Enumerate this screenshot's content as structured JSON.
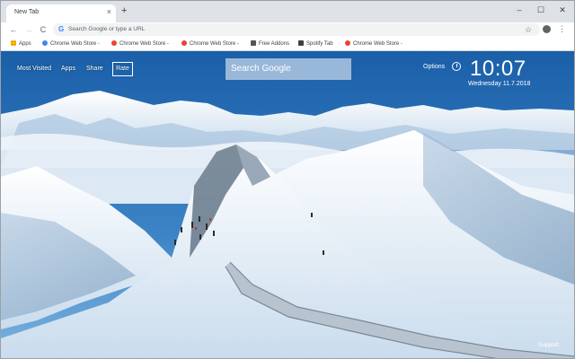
{
  "browser": {
    "tab_title": "New Tab",
    "tab_close": "×",
    "new_tab": "+",
    "window_minimize": "–",
    "window_maximize": "☐",
    "window_close": "✕",
    "back": "←",
    "forward": "→",
    "reload": "C",
    "omnibox_logo": "G",
    "omnibox_placeholder": "Search Google or type a URL",
    "star": "☆",
    "menu": "⋮"
  },
  "bookmarks": [
    {
      "label": "Apps",
      "icon": "apps-icon"
    },
    {
      "label": "Chrome Web Store -",
      "icon": "chrome-web-store-icon"
    },
    {
      "label": "Chrome Web Store -",
      "icon": "chrome-web-store-icon"
    },
    {
      "label": "Chrome Web Store -",
      "icon": "chrome-web-store-icon"
    },
    {
      "label": "Free Addons",
      "icon": "free-addons-icon"
    },
    {
      "label": "Spotify Tab",
      "icon": "spotify-tab-icon"
    },
    {
      "label": "Chrome Web Store -",
      "icon": "chrome-web-store-icon"
    }
  ],
  "page": {
    "links": {
      "most_visited": "Most Visited",
      "apps": "Apps",
      "share": "Share",
      "rate": "Rate"
    },
    "search_placeholder": "Search Google",
    "options": "Options",
    "time": "10:07",
    "date": "Wednesday  11.7.2018",
    "support": "Support"
  }
}
